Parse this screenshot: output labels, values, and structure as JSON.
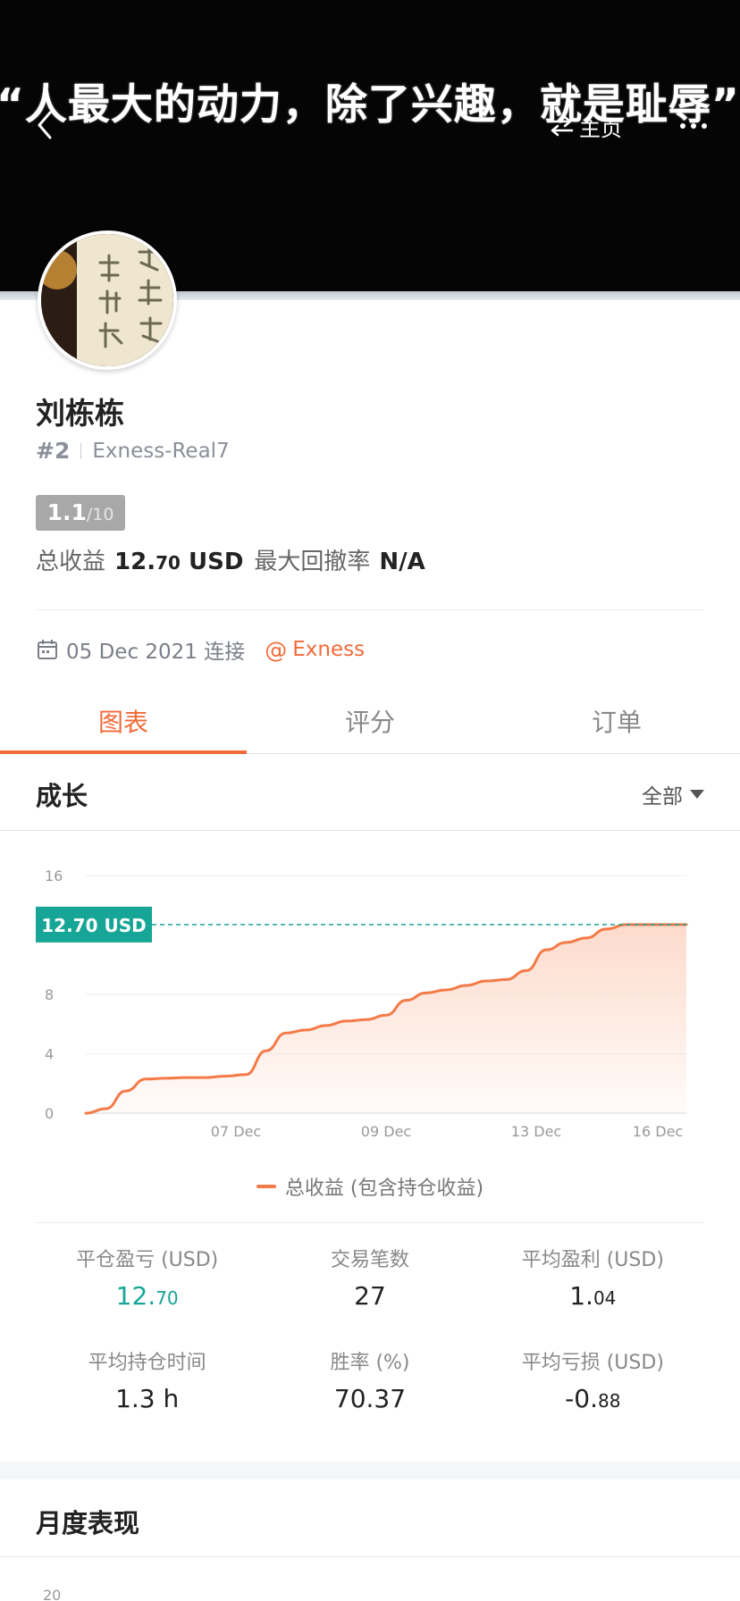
{
  "banner": {
    "quote": "“人最大的动力，除了兴趣，就是耻辱”",
    "home_label": "主页"
  },
  "profile": {
    "name": "刘栋栋",
    "rank": "#2",
    "server": "Exness-Real7",
    "score": "1.1",
    "score_max": "/10",
    "total_profit_label": "总收益",
    "total_profit_int": "12.",
    "total_profit_dec": "70",
    "total_profit_unit": "USD",
    "max_drawdown_label": "最大回撤率",
    "max_drawdown_value": "N/A",
    "connect_date": "05 Dec 2021 连接",
    "broker": "Exness"
  },
  "tabs": [
    {
      "label": "图表",
      "active": true
    },
    {
      "label": "评分",
      "active": false
    },
    {
      "label": "订单",
      "active": false
    }
  ],
  "growth": {
    "title": "成长",
    "range": "全部"
  },
  "chart_data": {
    "type": "area",
    "y_ticks": [
      "16",
      "8",
      "4",
      "0"
    ],
    "x_ticks": [
      "07 Dec",
      "09 Dec",
      "13 Dec",
      "16 Dec"
    ],
    "ylim": [
      0,
      16
    ],
    "current_label": "12.70 USD",
    "current_value": 12.7,
    "series": [
      {
        "name": "总收益 (包含持仓收益)",
        "values": [
          0,
          0.3,
          1.5,
          2.3,
          2.35,
          2.4,
          2.4,
          2.5,
          2.6,
          4.2,
          5.4,
          5.6,
          5.9,
          6.2,
          6.3,
          6.6,
          7.6,
          8.1,
          8.3,
          8.6,
          8.9,
          9.0,
          9.6,
          11.0,
          11.5,
          11.8,
          12.4,
          12.7,
          12.7,
          12.7,
          12.7
        ]
      }
    ],
    "colors": {
      "line": "#f47a48",
      "fill": "#fdd9c9",
      "marker": "#16a596"
    }
  },
  "stats": [
    {
      "label": "平仓盈亏 (USD)",
      "int": "12.",
      "dec": "70",
      "green": true
    },
    {
      "label": "交易笔数",
      "int": "27",
      "dec": "",
      "green": false
    },
    {
      "label": "平均盈利 (USD)",
      "int": "1.",
      "dec": "04",
      "green": false
    },
    {
      "label": "平均持仓时间",
      "int": "1.3 h",
      "dec": "",
      "green": false
    },
    {
      "label": "胜率 (%)",
      "int": "70.37",
      "dec": "",
      "green": false
    },
    {
      "label": "平均亏损 (USD)",
      "int": "-0.",
      "dec": "88",
      "green": false
    }
  ],
  "monthly": {
    "title": "月度表现",
    "first_tick": "20"
  }
}
